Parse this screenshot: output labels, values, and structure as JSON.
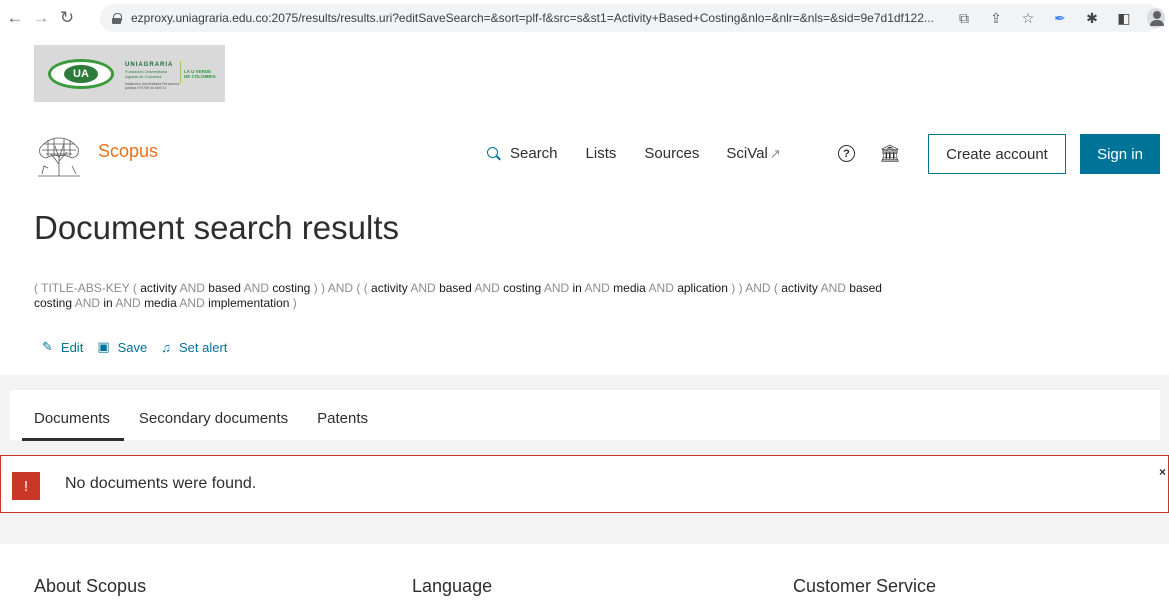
{
  "browser": {
    "url": "ezproxy.uniagraria.edu.co:2075/results/results.uri?editSaveSearch=&sort=plf-f&src=s&st1=Activity+Based+Costing&nlo=&nlr=&nls=&sid=9e7d1df122...",
    "back_icon": "arrow-left-icon",
    "forward_icon": "arrow-right-icon",
    "reload_icon": "reload-icon"
  },
  "institution": {
    "logo_text": "UA",
    "name": "UNIAGRARIA",
    "subtitle": "Fundación Universitaria Agraria de Colombia",
    "fine_print": "Institución Universitaria Personería jurídica N°5759 de Abril 11",
    "slogan_line1": "LA U VERDE",
    "slogan_line2": "DE COLOMBIA"
  },
  "header": {
    "brand": "Scopus",
    "nav": {
      "search": "Search",
      "lists": "Lists",
      "sources": "Sources",
      "scival": "SciVal",
      "scival_ext": "↗"
    },
    "help_glyph": "?",
    "institution_glyph": "🏛",
    "create_account": "Create account",
    "sign_in": "Sign in"
  },
  "page": {
    "title": "Document search results"
  },
  "query": {
    "t1": "( TITLE-ABS-KEY ( ",
    "w1": "activity",
    "k1": " AND ",
    "w2": "based",
    "k2": " AND ",
    "w3": "costing",
    "t2": " ) )  AND  ( ( ",
    "w4": "activity",
    "k3": " AND ",
    "w5": "based",
    "k4": " AND ",
    "w6": "costing",
    "k5": " AND ",
    "w7": "in",
    "k6": " AND ",
    "w8": "media",
    "k7": " AND ",
    "w9": "aplication",
    "t3": " ) )  AND  ( ",
    "w10": "activity",
    "k8": " AND ",
    "w11": "based",
    "k9": " AND ",
    "w12": "costing",
    "k10": " AND ",
    "w13": "in",
    "k11": " AND ",
    "w14": "media",
    "k12": " AND ",
    "w15": "implementation",
    "t4": " )"
  },
  "actions": {
    "edit": "Edit",
    "save": "Save",
    "alert": "Set alert"
  },
  "tabs": [
    "Documents",
    "Secondary documents",
    "Patents"
  ],
  "alert": {
    "badge": "!",
    "message": "No documents were found.",
    "close": "×"
  },
  "footer": {
    "about": "About Scopus",
    "language": "Language",
    "customer_service": "Customer Service"
  },
  "colors": {
    "accent": "#007398",
    "brand_orange": "#e9711c",
    "error": "#c83727"
  }
}
